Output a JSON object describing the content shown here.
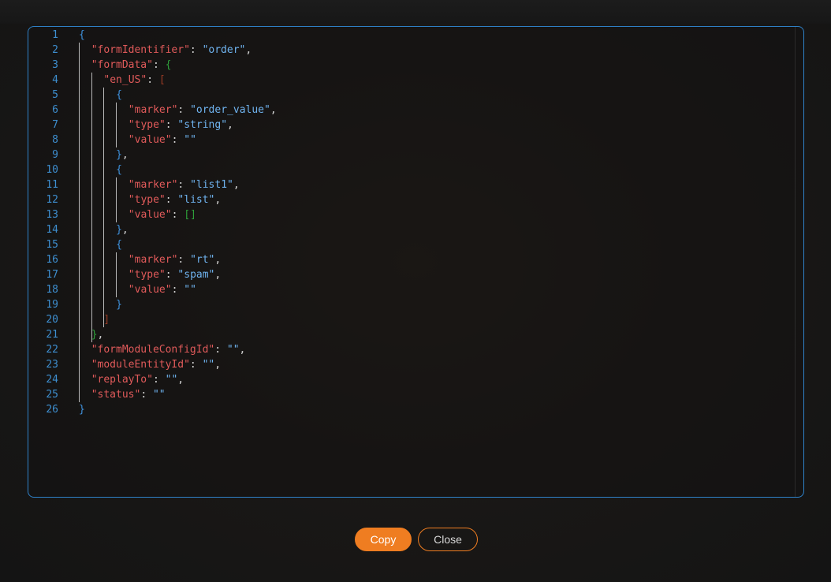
{
  "colors": {
    "accent": "#ef7d21",
    "border": "#2f82c9",
    "key": "#e05a5a",
    "string": "#6fb3ef",
    "line_number": "#3e8fd0",
    "bracket_level1": "#3f92dd",
    "bracket_level2": "#2e9f3a",
    "bracket_level3": "#9b3b24"
  },
  "editor": {
    "lines": [
      {
        "n": "1",
        "tokens": [
          [
            "{",
            "b1"
          ]
        ]
      },
      {
        "n": "2",
        "tokens": [
          [
            "\"formIdentifier\"",
            "k"
          ],
          [
            ": ",
            "p"
          ],
          [
            "\"order\"",
            "s"
          ],
          [
            ",",
            "p"
          ]
        ]
      },
      {
        "n": "3",
        "tokens": [
          [
            "\"formData\"",
            "k"
          ],
          [
            ": ",
            "p"
          ],
          [
            "{",
            "b2"
          ]
        ]
      },
      {
        "n": "4",
        "tokens": [
          [
            "\"en_US\"",
            "k"
          ],
          [
            ": ",
            "p"
          ],
          [
            "[",
            "b3"
          ]
        ]
      },
      {
        "n": "5",
        "tokens": [
          [
            "{",
            "b1"
          ]
        ]
      },
      {
        "n": "6",
        "tokens": [
          [
            "\"marker\"",
            "k"
          ],
          [
            ": ",
            "p"
          ],
          [
            "\"order_value\"",
            "s"
          ],
          [
            ",",
            "p"
          ]
        ]
      },
      {
        "n": "7",
        "tokens": [
          [
            "\"type\"",
            "k"
          ],
          [
            ": ",
            "p"
          ],
          [
            "\"string\"",
            "s"
          ],
          [
            ",",
            "p"
          ]
        ]
      },
      {
        "n": "8",
        "tokens": [
          [
            "\"value\"",
            "k"
          ],
          [
            ": ",
            "p"
          ],
          [
            "\"\"",
            "s"
          ]
        ]
      },
      {
        "n": "9",
        "tokens": [
          [
            "}",
            "b1"
          ],
          [
            ",",
            "p"
          ]
        ]
      },
      {
        "n": "10",
        "tokens": [
          [
            "{",
            "b1"
          ]
        ]
      },
      {
        "n": "11",
        "tokens": [
          [
            "\"marker\"",
            "k"
          ],
          [
            ": ",
            "p"
          ],
          [
            "\"list1\"",
            "s"
          ],
          [
            ",",
            "p"
          ]
        ]
      },
      {
        "n": "12",
        "tokens": [
          [
            "\"type\"",
            "k"
          ],
          [
            ": ",
            "p"
          ],
          [
            "\"list\"",
            "s"
          ],
          [
            ",",
            "p"
          ]
        ]
      },
      {
        "n": "13",
        "tokens": [
          [
            "\"value\"",
            "k"
          ],
          [
            ": ",
            "p"
          ],
          [
            "[]",
            "b2"
          ]
        ]
      },
      {
        "n": "14",
        "tokens": [
          [
            "}",
            "b1"
          ],
          [
            ",",
            "p"
          ]
        ]
      },
      {
        "n": "15",
        "tokens": [
          [
            "{",
            "b1"
          ]
        ]
      },
      {
        "n": "16",
        "tokens": [
          [
            "\"marker\"",
            "k"
          ],
          [
            ": ",
            "p"
          ],
          [
            "\"rt\"",
            "s"
          ],
          [
            ",",
            "p"
          ]
        ]
      },
      {
        "n": "17",
        "tokens": [
          [
            "\"type\"",
            "k"
          ],
          [
            ": ",
            "p"
          ],
          [
            "\"spam\"",
            "s"
          ],
          [
            ",",
            "p"
          ]
        ]
      },
      {
        "n": "18",
        "tokens": [
          [
            "\"value\"",
            "k"
          ],
          [
            ": ",
            "p"
          ],
          [
            "\"\"",
            "s"
          ]
        ]
      },
      {
        "n": "19",
        "tokens": [
          [
            "}",
            "b1"
          ]
        ]
      },
      {
        "n": "20",
        "tokens": [
          [
            "]",
            "b3"
          ]
        ]
      },
      {
        "n": "21",
        "tokens": [
          [
            "}",
            "b2"
          ],
          [
            ",",
            "p"
          ]
        ]
      },
      {
        "n": "22",
        "tokens": [
          [
            "\"formModuleConfigId\"",
            "k"
          ],
          [
            ": ",
            "p"
          ],
          [
            "\"\"",
            "s"
          ],
          [
            ",",
            "p"
          ]
        ]
      },
      {
        "n": "23",
        "tokens": [
          [
            "\"moduleEntityId\"",
            "k"
          ],
          [
            ": ",
            "p"
          ],
          [
            "\"\"",
            "s"
          ],
          [
            ",",
            "p"
          ]
        ]
      },
      {
        "n": "24",
        "tokens": [
          [
            "\"replayTo\"",
            "k"
          ],
          [
            ": ",
            "p"
          ],
          [
            "\"\"",
            "s"
          ],
          [
            ",",
            "p"
          ]
        ]
      },
      {
        "n": "25",
        "tokens": [
          [
            "\"status\"",
            "k"
          ],
          [
            ": ",
            "p"
          ],
          [
            "\"\"",
            "s"
          ]
        ]
      },
      {
        "n": "26",
        "tokens": [
          [
            "}",
            "b1"
          ]
        ]
      }
    ]
  },
  "buttons": {
    "copy_label": "Copy",
    "close_label": "Close"
  }
}
